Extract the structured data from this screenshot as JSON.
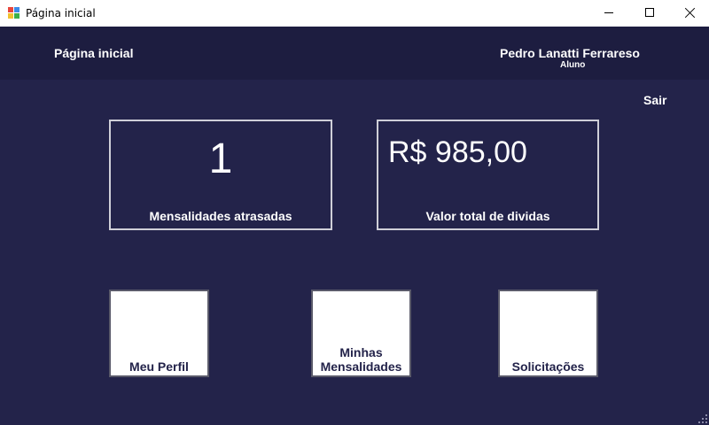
{
  "window": {
    "title": "Página inicial",
    "icon": "app-icon"
  },
  "header": {
    "page_title": "Página inicial",
    "user_name": "Pedro Lanatti Ferrareso",
    "user_role": "Aluno"
  },
  "logout_label": "Sair",
  "stats": [
    {
      "value": "1",
      "label": "Mensalidades atrasadas"
    },
    {
      "value": "R$ 985,00",
      "label": "Valor total de dividas"
    }
  ],
  "tiles": [
    {
      "line1": "Meu Perfil",
      "line2": ""
    },
    {
      "line1": "Minhas",
      "line2": "Mensalidades"
    },
    {
      "line1": "Solicitações",
      "line2": ""
    }
  ],
  "colors": {
    "background": "#23234a",
    "header": "#1d1d40",
    "tile": "#ffffff"
  }
}
